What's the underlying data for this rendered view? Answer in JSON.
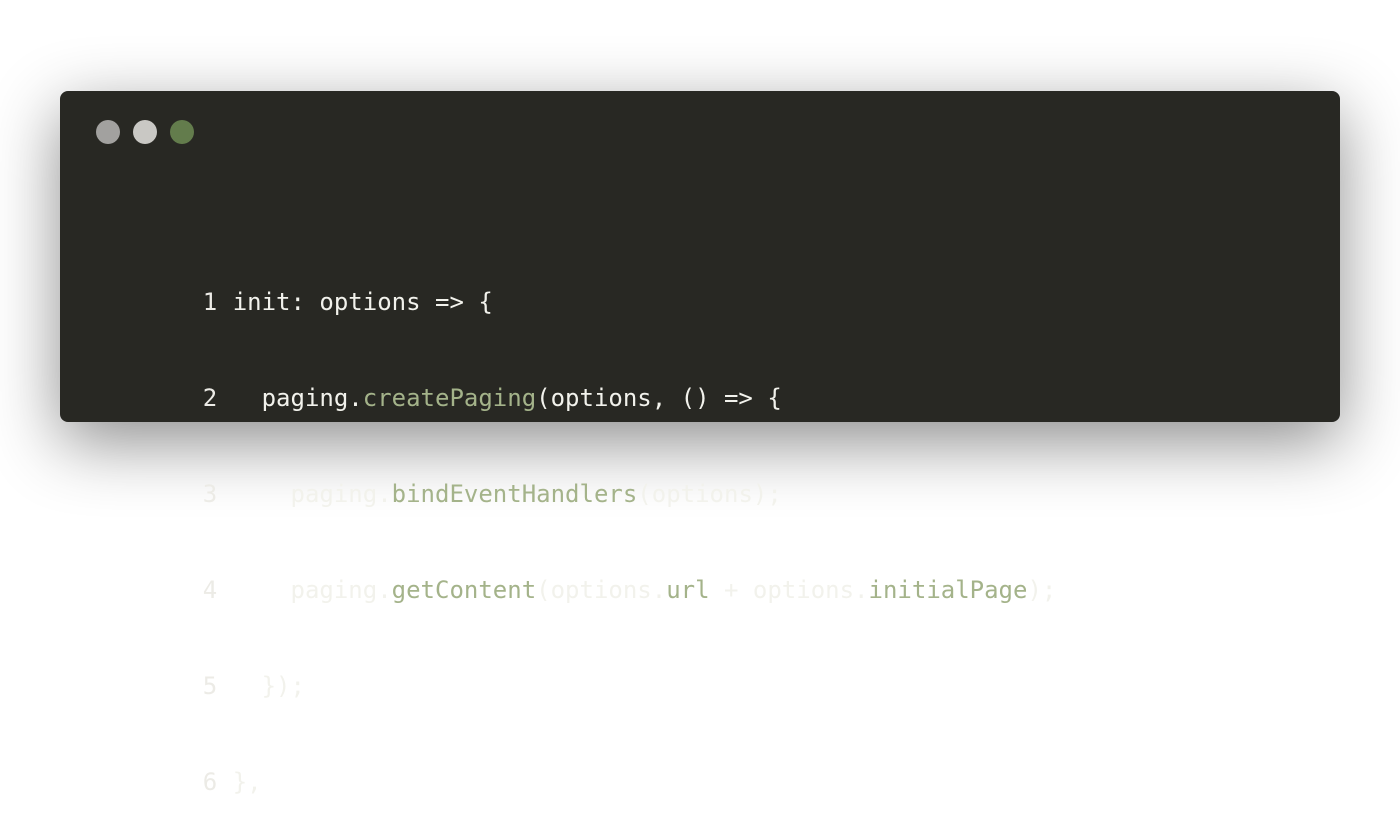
{
  "window": {
    "buttons": [
      {
        "name": "close",
        "color": "#a2a19f"
      },
      {
        "name": "minimize",
        "color": "#c9c8c4"
      },
      {
        "name": "maximize",
        "color": "#637c4c"
      }
    ],
    "background": "#282823"
  },
  "colors": {
    "text": "#f2f2ec",
    "method": "#a4b38a"
  },
  "code": {
    "lines": [
      {
        "number": "1",
        "tokens": [
          {
            "t": "init: options => {",
            "k": "p"
          }
        ]
      },
      {
        "number": "2",
        "tokens": [
          {
            "t": "  paging.",
            "k": "p"
          },
          {
            "t": "createPaging",
            "k": "m"
          },
          {
            "t": "(options, () => {",
            "k": "p"
          }
        ]
      },
      {
        "number": "3",
        "tokens": [
          {
            "t": "    paging.",
            "k": "p"
          },
          {
            "t": "bindEventHandlers",
            "k": "m"
          },
          {
            "t": "(options);",
            "k": "p"
          }
        ]
      },
      {
        "number": "4",
        "tokens": [
          {
            "t": "    paging.",
            "k": "p"
          },
          {
            "t": "getContent",
            "k": "m"
          },
          {
            "t": "(options.",
            "k": "p"
          },
          {
            "t": "url",
            "k": "m"
          },
          {
            "t": " + options.",
            "k": "p"
          },
          {
            "t": "initialPage",
            "k": "m"
          },
          {
            "t": ");",
            "k": "p"
          }
        ]
      },
      {
        "number": "5",
        "tokens": [
          {
            "t": "  });",
            "k": "p"
          }
        ]
      },
      {
        "number": "6",
        "tokens": [
          {
            "t": "},",
            "k": "p"
          }
        ]
      }
    ]
  }
}
